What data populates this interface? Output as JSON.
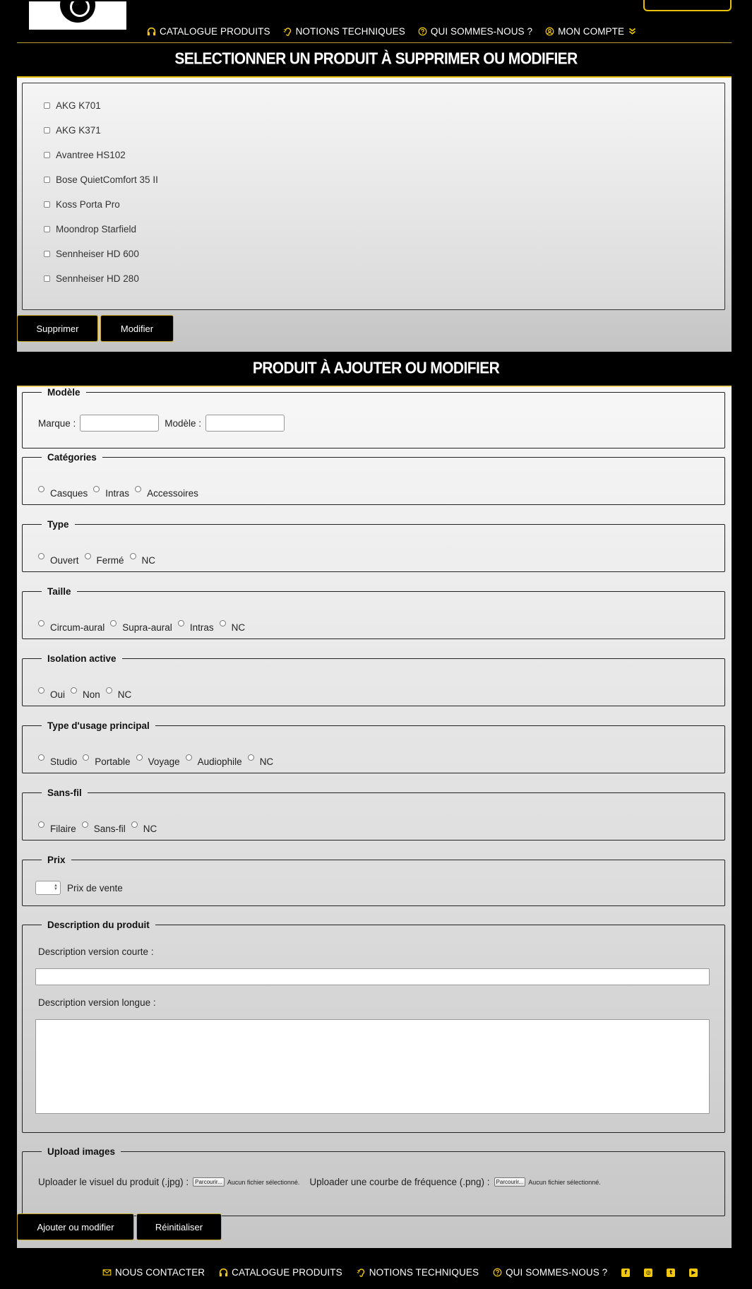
{
  "nav": {
    "items": [
      {
        "label": "CATALOGUE PRODUITS",
        "icon": "headphones-icon"
      },
      {
        "label": "NOTIONS TECHNIQUES",
        "icon": "ear-icon"
      },
      {
        "label": "QUI SOMMES-NOUS ?",
        "icon": "question-circle-icon"
      },
      {
        "label": "MON COMPTE",
        "icon": "user-circle-icon"
      }
    ],
    "account_chevron_icon": "double-chevron-down-icon"
  },
  "select_section": {
    "title": "SELECTIONNER UN PRODUIT À SUPPRIMER OU MODIFIER",
    "products": [
      "AKG K701",
      "AKG K371",
      "Avantree HS102",
      "Bose QuietComfort 35 II",
      "Koss Porta Pro",
      "Moondrop Starfield",
      "Sennheiser HD 600",
      "Sennheiser HD 280"
    ],
    "delete_button": "Supprimer",
    "modify_button": "Modifier"
  },
  "form_section": {
    "title": "PRODUIT À AJOUTER OU MODIFIER",
    "modele": {
      "legend": "Modèle",
      "marque_label": "Marque :",
      "modele_label": "Modèle :"
    },
    "categories": {
      "legend": "Catégories",
      "options": [
        "Casques",
        "Intras",
        "Accessoires"
      ]
    },
    "type": {
      "legend": "Type",
      "options": [
        "Ouvert",
        "Fermé",
        "NC"
      ]
    },
    "taille": {
      "legend": "Taille",
      "options": [
        "Circum-aural",
        "Supra-aural",
        "Intras",
        "NC"
      ]
    },
    "isolation": {
      "legend": "Isolation active",
      "options": [
        "Oui",
        "Non",
        "NC"
      ]
    },
    "usage": {
      "legend": "Type d'usage principal",
      "options": [
        "Studio",
        "Portable",
        "Voyage",
        "Audiophile",
        "NC"
      ]
    },
    "sansfil": {
      "legend": "Sans-fil",
      "options": [
        "Filaire",
        "Sans-fil",
        "NC"
      ]
    },
    "prix": {
      "legend": "Prix",
      "label": "Prix de vente"
    },
    "description": {
      "legend": "Description du produit",
      "short_label": "Description version courte :",
      "long_label": "Description version longue :"
    },
    "upload": {
      "legend": "Upload images",
      "visual_label": "Uploader le visuel du produit (.jpg) :",
      "curve_label": "Uploader une courbe de fréquence (.png) :",
      "browse_label": "Parcourir...",
      "no_file": "Aucun fichier sélectionné."
    },
    "submit_button": "Ajouter ou modifier",
    "reset_button": "Réinitialiser"
  },
  "footer": {
    "items": [
      {
        "label": "NOUS CONTACTER",
        "icon": "envelope-icon"
      },
      {
        "label": "CATALOGUE PRODUITS",
        "icon": "headphones-icon"
      },
      {
        "label": "NOTIONS TECHNIQUES",
        "icon": "ear-icon"
      },
      {
        "label": "QUI SOMMES-NOUS ?",
        "icon": "question-circle-icon"
      }
    ],
    "social": [
      "facebook-icon",
      "instagram-icon",
      "twitter-icon",
      "youtube-icon"
    ]
  },
  "colors": {
    "accent": "#f2c80f",
    "background": "#000000"
  }
}
